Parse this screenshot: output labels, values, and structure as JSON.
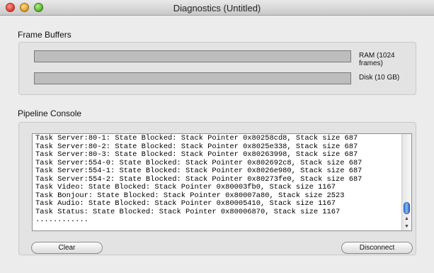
{
  "window": {
    "title": "Diagnostics (Untitled)"
  },
  "frame_buffers": {
    "heading": "Frame Buffers",
    "ram": {
      "label": "RAM (1024 frames)",
      "fill_fraction": 0.0
    },
    "disk": {
      "label": "Disk (10 GB)",
      "fill_fraction": 0.0
    }
  },
  "pipeline_console": {
    "heading": "Pipeline Console",
    "lines": [
      "Task Server:80-1: State Blocked: Stack Pointer 0x80258cd8, Stack size 687",
      "Task Server:80-2: State Blocked: Stack Pointer 0x8025e338, Stack size 687",
      "Task Server:80-3: State Blocked: Stack Pointer 0x80263998, Stack size 687",
      "Task Server:554-0: State Blocked: Stack Pointer 0x802692c8, Stack size 687",
      "Task Server:554-1: State Blocked: Stack Pointer 0x8026e980, Stack size 687",
      "Task Server:554-2: State Blocked: Stack Pointer 0x80273fe0, Stack size 687",
      "Task Video: State Blocked: Stack Pointer 0x80003fb0, Stack size 1167",
      "Task Bonjour: State Blocked: Stack Pointer 0x80007a80, Stack size 2523",
      "Task Audio: State Blocked: Stack Pointer 0x80005410, Stack size 1167",
      "Task Status: State Blocked: Stack Pointer 0x80006870, Stack size 1167",
      "............"
    ],
    "clear_label": "Clear",
    "disconnect_label": "Disconnect"
  },
  "icons": {
    "close": "close-icon",
    "minimize": "minimize-icon",
    "zoom": "zoom-icon",
    "scroll_up": "arrow-up-icon",
    "scroll_down": "arrow-down-icon"
  },
  "colors": {
    "bar_fill": "#2f6dd8",
    "bar_track": "#bdbdbd",
    "window_bg": "#ececec"
  }
}
